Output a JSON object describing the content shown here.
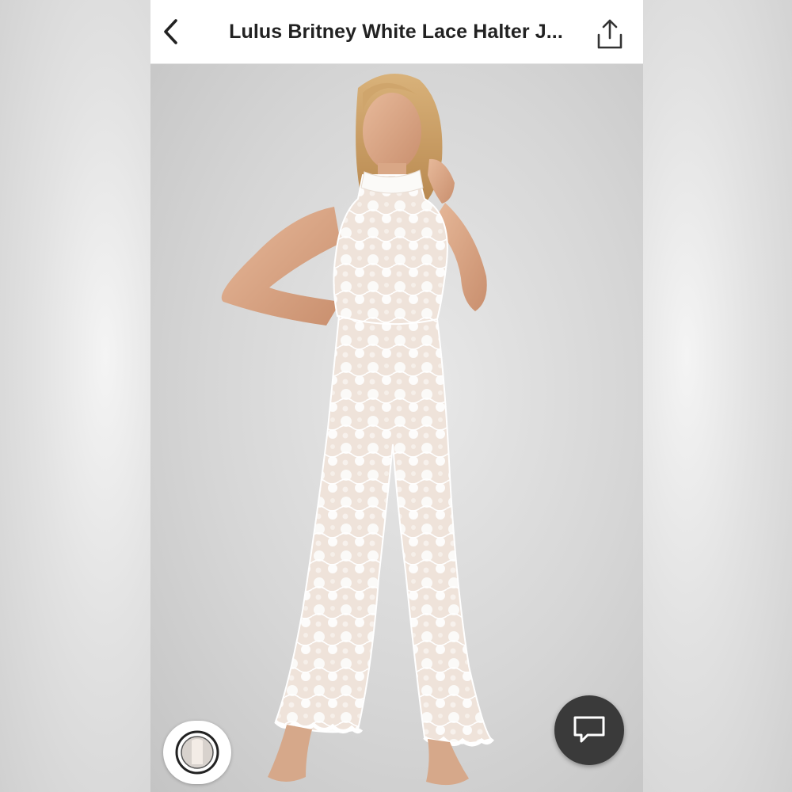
{
  "header": {
    "title": "Lulus Britney White Lace Halter J...",
    "back_icon": "chevron-left-icon",
    "share_icon": "share-upload-icon"
  },
  "photo": {
    "subject": "product-photo"
  },
  "controls": {
    "thumbnail_icon": "image-thumbnail-icon",
    "chat_icon": "chat-bubble-icon"
  },
  "colors": {
    "header_bg": "#ffffff",
    "title_text": "#222222",
    "chat_button_bg": "#3a3a3a"
  }
}
